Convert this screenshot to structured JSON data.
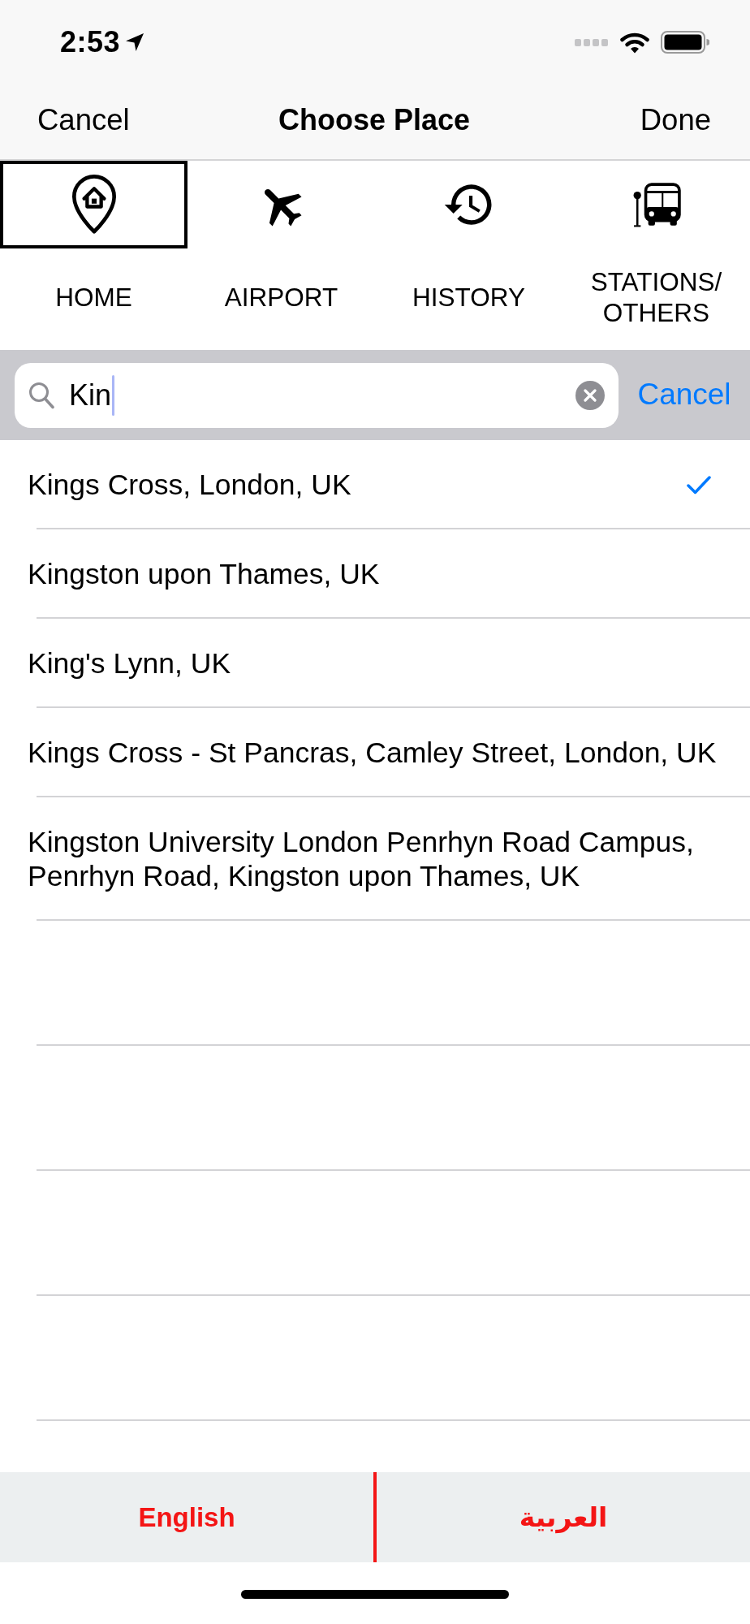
{
  "status_bar": {
    "time": "2:53"
  },
  "nav": {
    "cancel": "Cancel",
    "title": "Choose Place",
    "done": "Done"
  },
  "tabs": [
    {
      "kind": "home",
      "label": "HOME",
      "selected": true
    },
    {
      "kind": "airport",
      "label": "AIRPORT",
      "selected": false
    },
    {
      "kind": "history",
      "label": "HISTORY",
      "selected": false
    },
    {
      "kind": "stations",
      "label": "STATIONS/ OTHERS",
      "selected": false
    }
  ],
  "search": {
    "value": "Kin",
    "focused": true,
    "cancel": "Cancel"
  },
  "results": [
    {
      "name": "Kings Cross, London, UK",
      "selected": true
    },
    {
      "name": "Kingston upon Thames, UK",
      "selected": false
    },
    {
      "name": "King's Lynn, UK",
      "selected": false
    },
    {
      "name": "Kings Cross - St Pancras, Camley Street, London, UK",
      "selected": false
    },
    {
      "name": "Kingston University London Penrhyn Road Campus, Penrhyn Road, Kingston upon Thames, UK",
      "selected": false
    }
  ],
  "language_bar": {
    "buttons": [
      "English",
      "العربية"
    ]
  }
}
